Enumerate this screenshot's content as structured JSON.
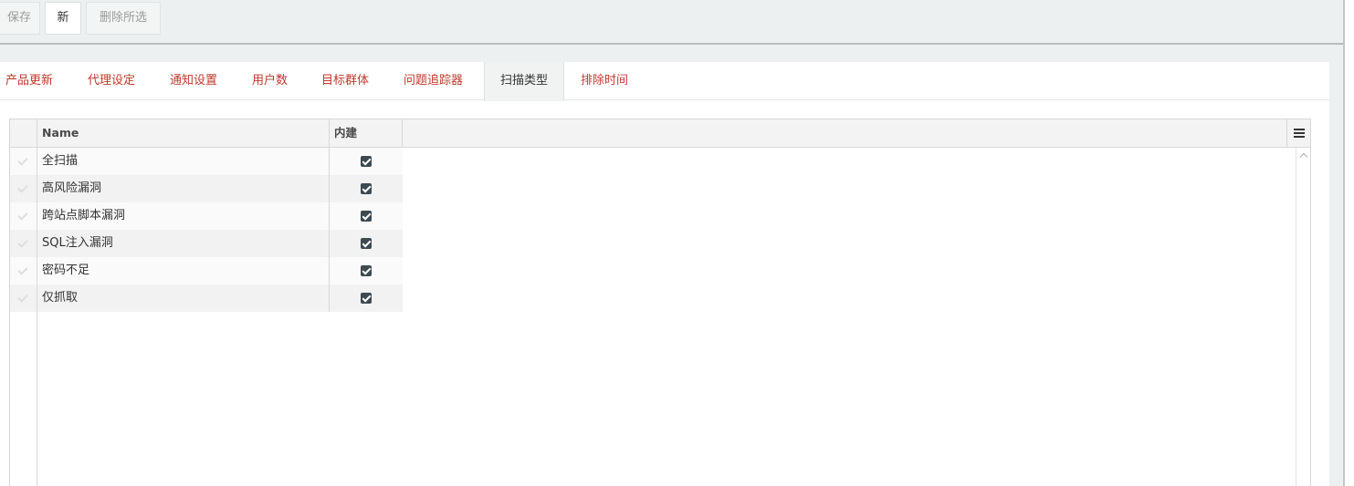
{
  "toolbar": {
    "save_label": "保存",
    "new_label": "新",
    "delete_selected_label": "删除所选"
  },
  "tabs": [
    {
      "label": "产品更新",
      "active": false
    },
    {
      "label": "代理设定",
      "active": false
    },
    {
      "label": "通知设置",
      "active": false
    },
    {
      "label": "用户数",
      "active": false
    },
    {
      "label": "目标群体",
      "active": false
    },
    {
      "label": "问题追踪器",
      "active": false
    },
    {
      "label": "扫描类型",
      "active": true
    },
    {
      "label": "排除时间",
      "active": false
    }
  ],
  "grid": {
    "columns": {
      "name": "Name",
      "builtin": "内建"
    },
    "rows": [
      {
        "name": "全扫描",
        "builtin": true
      },
      {
        "name": "高风险漏洞",
        "builtin": true
      },
      {
        "name": "跨站点脚本漏洞",
        "builtin": true
      },
      {
        "name": "SQL注入漏洞",
        "builtin": true
      },
      {
        "name": "密码不足",
        "builtin": true
      },
      {
        "name": "仅抓取",
        "builtin": true
      }
    ]
  },
  "colors": {
    "tab_text": "#c0392b",
    "toolbar_bg": "#ecf0f0",
    "checkbox_fill": "#3d4a50"
  },
  "icons": {
    "grid_menu": "hamburger-menu-icon",
    "row_select": "check-icon",
    "scroll_up": "chevron-up-icon"
  }
}
